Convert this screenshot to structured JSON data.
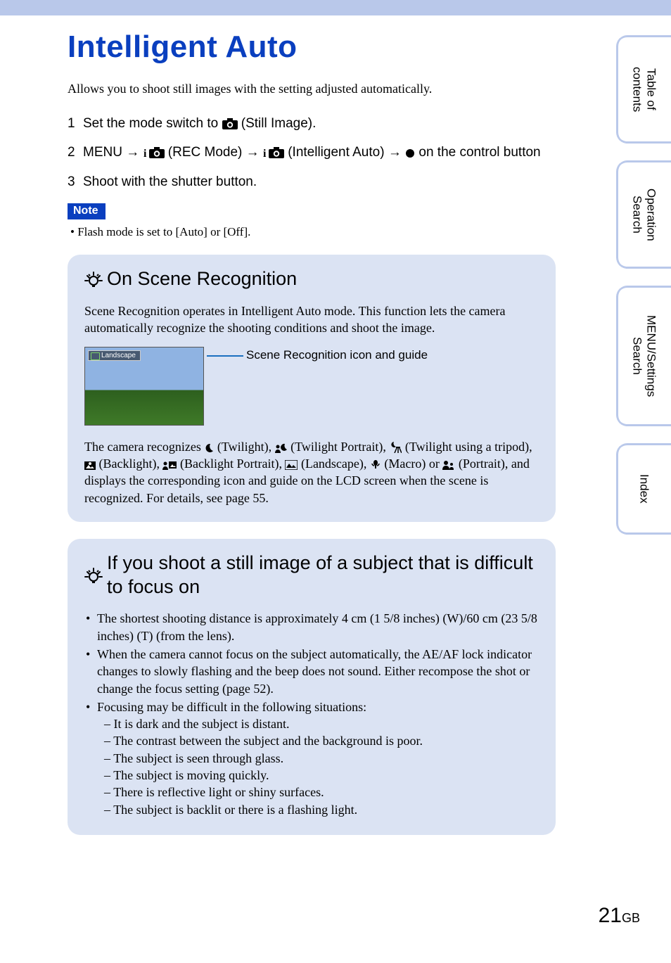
{
  "header": {
    "title": "Intelligent Auto"
  },
  "intro": "Allows you to shoot still images with the setting adjusted automatically.",
  "steps": {
    "s1_a": "Set the mode switch to ",
    "s1_b": " (Still Image).",
    "s2_a": "MENU ",
    "s2_b": " (REC Mode) ",
    "s2_c": " (Intelligent Auto) ",
    "s2_d": " on the control button",
    "s3": "Shoot with the shutter button."
  },
  "note": {
    "label": "Note",
    "text": "Flash mode is set to [Auto] or [Off]."
  },
  "panel1": {
    "heading": "On Scene Recognition",
    "p1": "Scene Recognition operates in Intelligent Auto mode. This function lets the camera automatically recognize the shooting conditions and shoot the image.",
    "thumb_label": "Landscape",
    "callout": "Scene Recognition icon and guide",
    "p2_a": "The camera recognizes ",
    "p2_twilight": " (Twilight), ",
    "p2_twport": " (Twilight Portrait), ",
    "p2_twtripod": " (Twilight using a tripod), ",
    "p2_back": " (Backlight), ",
    "p2_backport": " (Backlight Portrait), ",
    "p2_land": " (Landscape), ",
    "p2_macro": " (Macro) or ",
    "p2_port": " (Portrait), and displays the corresponding icon and guide on the LCD screen when the scene is recognized. For details, see page 55."
  },
  "panel2": {
    "heading": "If you shoot a still image of a subject that is difficult to focus on",
    "li1": "The shortest shooting distance is approximately 4 cm (1 5/8 inches) (W)/60 cm (23 5/8 inches) (T) (from the lens).",
    "li2": "When the camera cannot focus on the subject automatically, the AE/AF lock indicator changes to slowly flashing and the beep does not sound. Either recompose the shot or change the focus setting (page 52).",
    "li3": "Focusing may be difficult in the following situations:",
    "sub1": "It is dark and the subject is distant.",
    "sub2": "The contrast between the subject and the background is poor.",
    "sub3": "The subject is seen through glass.",
    "sub4": "The subject is moving quickly.",
    "sub5": "There is reflective light or shiny surfaces.",
    "sub6": "The subject is backlit or there is a flashing light."
  },
  "tabs": {
    "t1a": "Table of",
    "t1b": "contents",
    "t2a": "Operation",
    "t2b": "Search",
    "t3a": "MENU/Settings",
    "t3b": "Search",
    "t4": "Index"
  },
  "page": {
    "num": "21",
    "suffix": "GB"
  },
  "arrow": "→"
}
